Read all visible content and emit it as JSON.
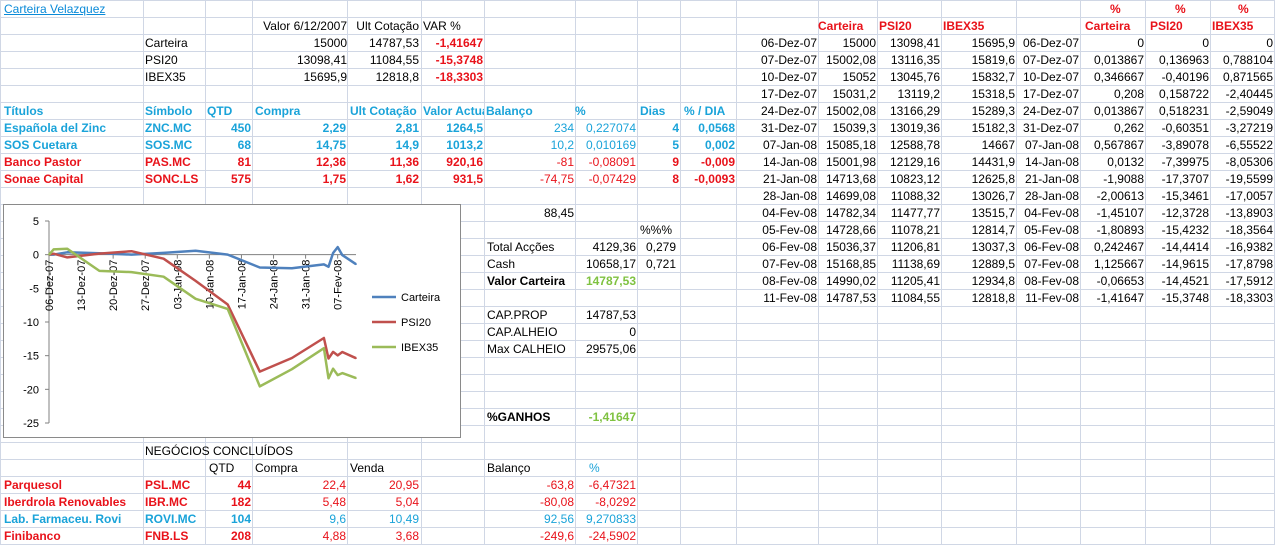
{
  "colors": {
    "blue": "#1aa3d9",
    "red": "#e8121a",
    "green": "#7fc241",
    "series_blue": "#4f81bd",
    "series_red": "#c0504d",
    "series_green": "#9bbb59"
  },
  "title": "Carteira Velazquez",
  "summary": {
    "headers": [
      "Valor 6/12/2007",
      "Ult Cotação",
      "VAR %"
    ],
    "rows": [
      {
        "label": "Carteira",
        "v": "15000",
        "ult": "14787,53",
        "var": "-1,41647"
      },
      {
        "label": "PSI20",
        "v": "13098,41",
        "ult": "11084,55",
        "var": "-15,3748"
      },
      {
        "label": "IBEX35",
        "v": "15695,9",
        "ult": "12818,8",
        "var": "-18,3303"
      }
    ]
  },
  "holdings": {
    "headers": [
      "Títulos",
      "Símbolo",
      "QTD",
      "Compra",
      "Ult Cotação",
      "Valor Actual",
      "Balanço",
      "%",
      "Dias",
      "% / DIA"
    ],
    "rows": [
      {
        "name": "Española del Zinc",
        "sym": "ZNC.MC",
        "qtd": "450",
        "compra": "2,29",
        "ult": "2,81",
        "valor": "1264,5",
        "bal": "234",
        "pct": "0,227074",
        "dias": "4",
        "pdia": "0,0568",
        "color": "blue"
      },
      {
        "name": "SOS Cuetara",
        "sym": "SOS.MC",
        "qtd": "68",
        "compra": "14,75",
        "ult": "14,9",
        "valor": "1013,2",
        "bal": "10,2",
        "pct": "0,010169",
        "dias": "5",
        "pdia": "0,002",
        "color": "blue"
      },
      {
        "name": "Banco Pastor",
        "sym": "PAS.MC",
        "qtd": "81",
        "compra": "12,36",
        "ult": "11,36",
        "valor": "920,16",
        "bal": "-81",
        "pct": "-0,08091",
        "dias": "9",
        "pdia": "-0,009",
        "color": "red"
      },
      {
        "name": "Sonae Capital",
        "sym": "SONC.LS",
        "qtd": "575",
        "compra": "1,75",
        "ult": "1,62",
        "valor": "931,5",
        "bal": "-74,75",
        "pct": "-0,07429",
        "dias": "8",
        "pdia": "-0,0093",
        "color": "red"
      }
    ]
  },
  "totals": {
    "sum": "88,45",
    "pct_header": "%%%",
    "acoes_label": "Total Acções",
    "acoes": "4129,36",
    "acoes_pct": "0,279",
    "cash_label": "Cash",
    "cash": "10658,17",
    "cash_pct": "0,721",
    "valor_label": "Valor Carteira",
    "valor": "14787,53",
    "cap_prop_label": "CAP.PROP",
    "cap_prop": "14787,53",
    "cap_alheio_label": "CAP.ALHEIO",
    "cap_alheio": "0",
    "max_label": "Max CALHEIO",
    "max": "29575,06",
    "ganhos_label": "%GANHOS",
    "ganhos": "-1,41647"
  },
  "closed": {
    "title": "NEGÓCIOS CONCLUÍDOS",
    "headers": [
      "QTD",
      "Compra",
      "Venda",
      "Balanço",
      "%"
    ],
    "rows": [
      {
        "name": "Parquesol",
        "sym": "PSL.MC",
        "qtd": "44",
        "compra": "22,4",
        "venda": "20,95",
        "bal": "-63,8",
        "pct": "-6,47321",
        "color": "red"
      },
      {
        "name": "Iberdrola Renovables",
        "sym": "IBR.MC",
        "qtd": "182",
        "compra": "5,48",
        "venda": "5,04",
        "bal": "-80,08",
        "pct": "-8,0292",
        "color": "red"
      },
      {
        "name": "Lab. Farmaceu. Rovi",
        "sym": "ROVI.MC",
        "qtd": "104",
        "compra": "9,6",
        "venda": "10,49",
        "bal": "92,56",
        "pct": "9,270833",
        "color": "blue"
      },
      {
        "name": "Finibanco",
        "sym": "FNB.LS",
        "qtd": "208",
        "compra": "4,88",
        "venda": "3,68",
        "bal": "-249,6",
        "pct": "-24,5902",
        "color": "red"
      }
    ]
  },
  "history": {
    "headers": [
      "Carteira",
      "PSI20",
      "IBEX35"
    ],
    "pct_symbol": "%",
    "rows": [
      {
        "d": "06-Dez-07",
        "c": "15000",
        "p": "13098,41",
        "i": "15695,9",
        "d2": "06-Dez-07",
        "pc": "0",
        "pp": "0",
        "pi": "0"
      },
      {
        "d": "07-Dez-07",
        "c": "15002,08",
        "p": "13116,35",
        "i": "15819,6",
        "d2": "07-Dez-07",
        "pc": "0,013867",
        "pp": "0,136963",
        "pi": "0,788104"
      },
      {
        "d": "10-Dez-07",
        "c": "15052",
        "p": "13045,76",
        "i": "15832,7",
        "d2": "10-Dez-07",
        "pc": "0,346667",
        "pp": "-0,40196",
        "pi": "0,871565"
      },
      {
        "d": "17-Dez-07",
        "c": "15031,2",
        "p": "13119,2",
        "i": "15318,5",
        "d2": "17-Dez-07",
        "pc": "0,208",
        "pp": "0,158722",
        "pi": "-2,40445"
      },
      {
        "d": "24-Dez-07",
        "c": "15002,08",
        "p": "13166,29",
        "i": "15289,3",
        "d2": "24-Dez-07",
        "pc": "0,013867",
        "pp": "0,518231",
        "pi": "-2,59049"
      },
      {
        "d": "31-Dez-07",
        "c": "15039,3",
        "p": "13019,36",
        "i": "15182,3",
        "d2": "31-Dez-07",
        "pc": "0,262",
        "pp": "-0,60351",
        "pi": "-3,27219"
      },
      {
        "d": "07-Jan-08",
        "c": "15085,18",
        "p": "12588,78",
        "i": "14667",
        "d2": "07-Jan-08",
        "pc": "0,567867",
        "pp": "-3,89078",
        "pi": "-6,55522"
      },
      {
        "d": "14-Jan-08",
        "c": "15001,98",
        "p": "12129,16",
        "i": "14431,9",
        "d2": "14-Jan-08",
        "pc": "0,0132",
        "pp": "-7,39975",
        "pi": "-8,05306"
      },
      {
        "d": "21-Jan-08",
        "c": "14713,68",
        "p": "10823,12",
        "i": "12625,8",
        "d2": "21-Jan-08",
        "pc": "-1,9088",
        "pp": "-17,3707",
        "pi": "-19,5599"
      },
      {
        "d": "28-Jan-08",
        "c": "14699,08",
        "p": "11088,32",
        "i": "13026,7",
        "d2": "28-Jan-08",
        "pc": "-2,00613",
        "pp": "-15,3461",
        "pi": "-17,0057"
      },
      {
        "d": "04-Fev-08",
        "c": "14782,34",
        "p": "11477,77",
        "i": "13515,7",
        "d2": "04-Fev-08",
        "pc": "-1,45107",
        "pp": "-12,3728",
        "pi": "-13,8903"
      },
      {
        "d": "05-Fev-08",
        "c": "14728,66",
        "p": "11078,21",
        "i": "12814,7",
        "d2": "05-Fev-08",
        "pc": "-1,80893",
        "pp": "-15,4232",
        "pi": "-18,3564"
      },
      {
        "d": "06-Fev-08",
        "c": "15036,37",
        "p": "11206,81",
        "i": "13037,3",
        "d2": "06-Fev-08",
        "pc": "0,242467",
        "pp": "-14,4414",
        "pi": "-16,9382"
      },
      {
        "d": "07-Fev-08",
        "c": "15168,85",
        "p": "11138,69",
        "i": "12889,5",
        "d2": "07-Fev-08",
        "pc": "1,125667",
        "pp": "-14,9615",
        "pi": "-17,8798"
      },
      {
        "d": "08-Fev-08",
        "c": "14990,02",
        "p": "11205,41",
        "i": "12934,8",
        "d2": "08-Fev-08",
        "pc": "-0,06653",
        "pp": "-14,4521",
        "pi": "-17,5912"
      },
      {
        "d": "11-Fev-08",
        "c": "14787,53",
        "p": "11084,55",
        "i": "12818,8",
        "d2": "11-Fev-08",
        "pc": "-1,41647",
        "pp": "-15,3748",
        "pi": "-18,3303"
      }
    ]
  },
  "chart_data": {
    "type": "line",
    "ylim": [
      -25,
      5
    ],
    "yticks": [
      "5",
      "0",
      "-5",
      "-10",
      "-15",
      "-20",
      "-25"
    ],
    "xticks": [
      "06-Dez-07",
      "13-Dez-07",
      "20-Dez-07",
      "27-Dez-07",
      "03-Jan-08",
      "10-Jan-08",
      "17-Jan-08",
      "24-Jan-08",
      "31-Jan-08",
      "07-Fev-08"
    ],
    "x": [
      "06-Dez-07",
      "07-Dez-07",
      "10-Dez-07",
      "17-Dez-07",
      "24-Dez-07",
      "31-Dez-07",
      "07-Jan-08",
      "14-Jan-08",
      "21-Jan-08",
      "28-Jan-08",
      "04-Fev-08",
      "05-Fev-08",
      "06-Fev-08",
      "07-Fev-08",
      "08-Fev-08",
      "11-Fev-08"
    ],
    "legend_position": "right",
    "series": [
      {
        "name": "Carteira",
        "color": "#4f81bd",
        "values": [
          0,
          0.013867,
          0.346667,
          0.208,
          0.013867,
          0.262,
          0.567867,
          0.0132,
          -1.9088,
          -2.00613,
          -1.45107,
          -1.80893,
          0.242467,
          1.125667,
          -0.06653,
          -1.41647
        ]
      },
      {
        "name": "PSI20",
        "color": "#c0504d",
        "values": [
          0,
          0.136963,
          -0.40196,
          0.158722,
          0.518231,
          -0.60351,
          -3.89078,
          -7.39975,
          -17.3707,
          -15.3461,
          -12.3728,
          -15.4232,
          -14.4414,
          -14.9615,
          -14.4521,
          -15.3748
        ]
      },
      {
        "name": "IBEX35",
        "color": "#9bbb59",
        "values": [
          0,
          0.788104,
          0.871565,
          -2.40445,
          -2.59049,
          -3.27219,
          -6.55522,
          -8.05306,
          -19.5599,
          -17.0057,
          -13.8903,
          -18.3564,
          -16.9382,
          -17.8798,
          -17.5912,
          -18.3303
        ]
      }
    ]
  }
}
